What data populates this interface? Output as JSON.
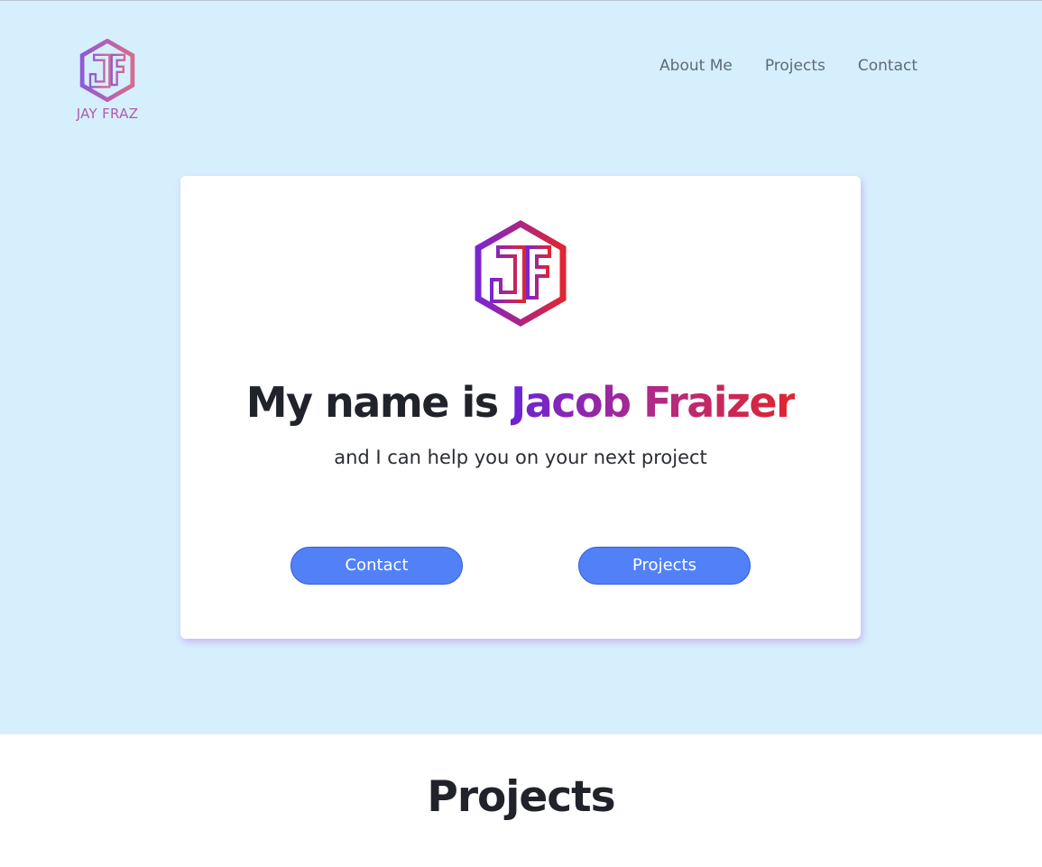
{
  "brand": {
    "logo_icon": "jf-hexagon-logo-icon",
    "name": "JAY FRAZ"
  },
  "nav": {
    "items": [
      {
        "label": "About Me"
      },
      {
        "label": "Projects"
      },
      {
        "label": "Contact"
      }
    ]
  },
  "hero": {
    "logo_icon": "jf-hexagon-logo-icon",
    "headline_prefix": "My name is ",
    "headline_name": "Jacob Fraizer",
    "tagline": "and I can help you on your next project",
    "buttons": {
      "contact_label": "Contact",
      "projects_label": "Projects"
    }
  },
  "projects_section": {
    "title": "Projects"
  },
  "colors": {
    "hero_background": "#d6effd",
    "button": "#5281f7",
    "gradient_start": "#6a23d6",
    "gradient_end": "#e0252e"
  }
}
